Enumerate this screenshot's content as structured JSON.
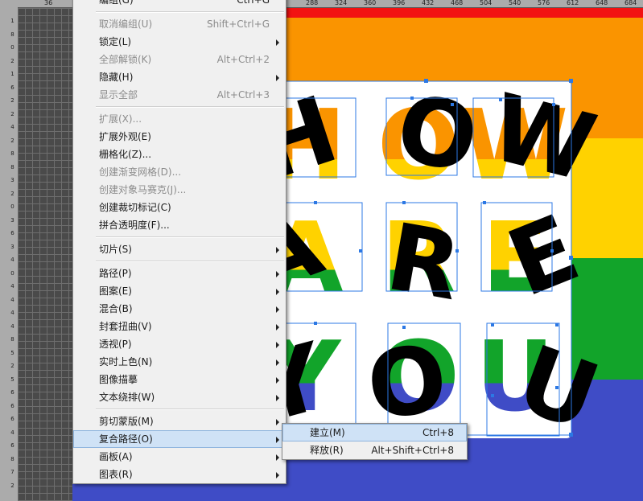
{
  "ruler": {
    "top_labels": [
      "36",
      "288",
      "324",
      "360",
      "396",
      "432",
      "468",
      "504",
      "540",
      "576",
      "612",
      "648",
      "684"
    ],
    "left_labels": [
      "1",
      "8",
      "0",
      "2",
      "1",
      "6",
      "2",
      "2",
      "4",
      "2",
      "8",
      "8",
      "3",
      "2",
      "0",
      "3",
      "6",
      "3",
      "4",
      "0",
      "4",
      "4",
      "4",
      "4",
      "8",
      "5",
      "2",
      "5",
      "6",
      "6",
      "6",
      "4",
      "6",
      "8",
      "7",
      "2"
    ]
  },
  "colors": {
    "orange": "#fa9400",
    "yellow": "#ffd200",
    "green": "#12a42a",
    "blue": "#3f4cc6",
    "red": "#f21212",
    "selection": "#2c78e4"
  },
  "letters": {
    "row1": [
      "H",
      "O",
      "W"
    ],
    "row2": [
      "A",
      "R",
      "E"
    ],
    "row3": [
      "Y",
      "O",
      "U"
    ]
  },
  "object_menu": {
    "items": [
      {
        "label": "编组(G)",
        "shortcut": "Ctrl+G",
        "disabled": false,
        "submenu": false
      },
      {
        "label": "取消编组(U)",
        "shortcut": "Shift+Ctrl+G",
        "disabled": true,
        "submenu": false
      },
      {
        "label": "锁定(L)",
        "shortcut": "",
        "disabled": false,
        "submenu": true
      },
      {
        "label": "全部解锁(K)",
        "shortcut": "Alt+Ctrl+2",
        "disabled": true,
        "submenu": false
      },
      {
        "label": "隐藏(H)",
        "shortcut": "",
        "disabled": false,
        "submenu": true
      },
      {
        "label": "显示全部",
        "shortcut": "Alt+Ctrl+3",
        "disabled": true,
        "submenu": false
      },
      {
        "label": "扩展(X)...",
        "shortcut": "",
        "disabled": true,
        "submenu": false
      },
      {
        "label": "扩展外观(E)",
        "shortcut": "",
        "disabled": false,
        "submenu": false
      },
      {
        "label": "栅格化(Z)...",
        "shortcut": "",
        "disabled": false,
        "submenu": false
      },
      {
        "label": "创建渐变网格(D)...",
        "shortcut": "",
        "disabled": true,
        "submenu": false
      },
      {
        "label": "创建对象马赛克(J)...",
        "shortcut": "",
        "disabled": true,
        "submenu": false
      },
      {
        "label": "创建裁切标记(C)",
        "shortcut": "",
        "disabled": false,
        "submenu": false
      },
      {
        "label": "拼合透明度(F)...",
        "shortcut": "",
        "disabled": false,
        "submenu": false
      },
      {
        "label": "切片(S)",
        "shortcut": "",
        "disabled": false,
        "submenu": true
      },
      {
        "label": "路径(P)",
        "shortcut": "",
        "disabled": false,
        "submenu": true
      },
      {
        "label": "图案(E)",
        "shortcut": "",
        "disabled": false,
        "submenu": true
      },
      {
        "label": "混合(B)",
        "shortcut": "",
        "disabled": false,
        "submenu": true
      },
      {
        "label": "封套扭曲(V)",
        "shortcut": "",
        "disabled": false,
        "submenu": true
      },
      {
        "label": "透视(P)",
        "shortcut": "",
        "disabled": false,
        "submenu": true
      },
      {
        "label": "实时上色(N)",
        "shortcut": "",
        "disabled": false,
        "submenu": true
      },
      {
        "label": "图像描摹",
        "shortcut": "",
        "disabled": false,
        "submenu": true
      },
      {
        "label": "文本绕排(W)",
        "shortcut": "",
        "disabled": false,
        "submenu": true
      },
      {
        "label": "剪切蒙版(M)",
        "shortcut": "",
        "disabled": false,
        "submenu": true
      },
      {
        "label": "复合路径(O)",
        "shortcut": "",
        "disabled": false,
        "submenu": true
      },
      {
        "label": "画板(A)",
        "shortcut": "",
        "disabled": false,
        "submenu": true
      },
      {
        "label": "图表(R)",
        "shortcut": "",
        "disabled": false,
        "submenu": true
      }
    ]
  },
  "compound_path_submenu": {
    "items": [
      {
        "label": "建立(M)",
        "shortcut": "Ctrl+8"
      },
      {
        "label": "释放(R)",
        "shortcut": "Alt+Shift+Ctrl+8"
      }
    ]
  }
}
